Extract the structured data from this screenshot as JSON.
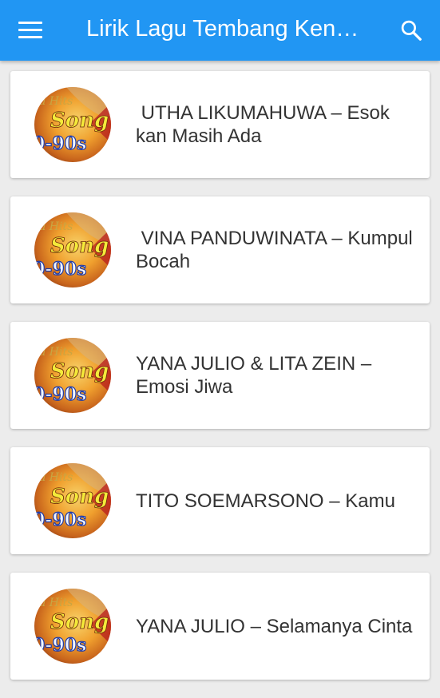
{
  "appbar": {
    "title": "Lirik Lagu Tembang Kenangan",
    "menu_icon": "hamburger-menu-icon",
    "search_icon": "search-icon",
    "background": "#2196f3"
  },
  "songs": [
    {
      "title": " UTHA LIKUMAHUWA – Esok kan Masih Ada",
      "thumbnail": "hits-song-90s-thumbnail"
    },
    {
      "title": " VINA PANDUWINATA – Kumpul Bocah",
      "thumbnail": "hits-song-90s-thumbnail"
    },
    {
      "title": "YANA JULIO & LITA ZEIN – Emosi Jiwa",
      "thumbnail": "hits-song-90s-thumbnail"
    },
    {
      "title": "TITO SOEMARSONO – Kamu",
      "thumbnail": "hits-song-90s-thumbnail"
    },
    {
      "title": "YANA JULIO – Selamanya Cinta",
      "thumbnail": "hits-song-90s-thumbnail"
    }
  ]
}
